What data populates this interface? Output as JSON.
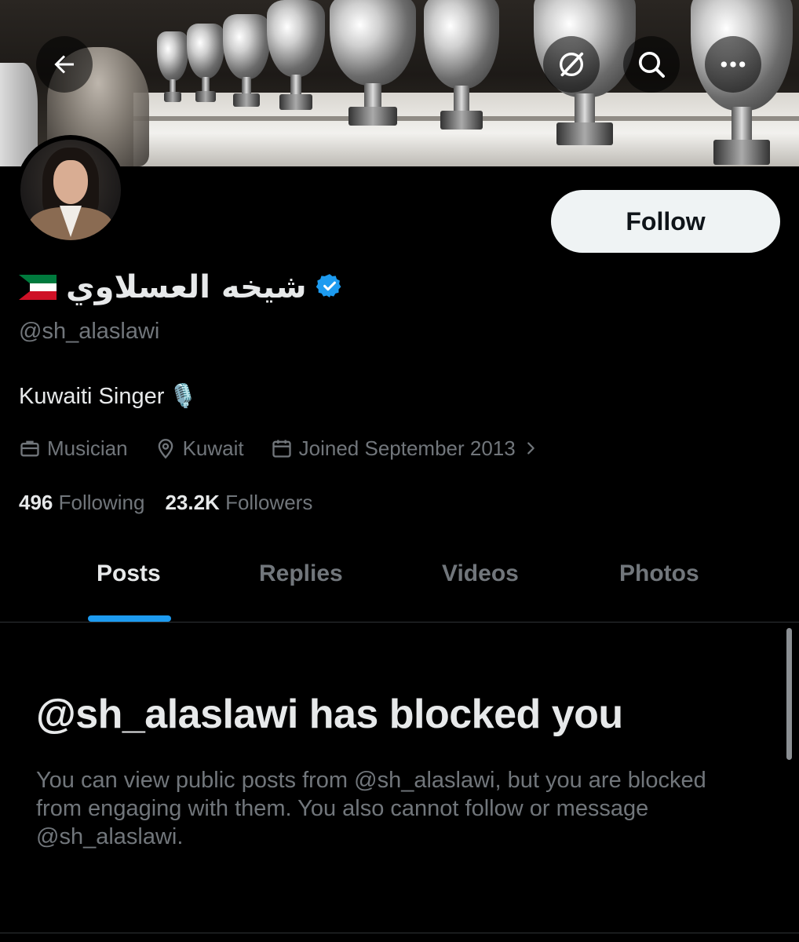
{
  "header": {
    "back_icon": "arrow-left-icon",
    "grok_icon": "grok-slash-circle-icon",
    "search_icon": "search-icon",
    "more_icon": "more-horizontal-icon"
  },
  "profile": {
    "display_name": "شيخه العسلاوي",
    "flag_icon": "kuwait-flag-icon",
    "verified_icon": "verified-badge-icon",
    "verified_color": "#1d9bf0",
    "handle": "@sh_alaslawi",
    "bio": "Kuwaiti Singer",
    "bio_emoji": "🎙️",
    "category": "Musician",
    "location": "Kuwait",
    "joined": "Joined September 2013",
    "following_count": "496",
    "following_label": "Following",
    "followers_count": "23.2K",
    "followers_label": "Followers",
    "follow_button": "Follow"
  },
  "tabs": [
    {
      "label": "Posts",
      "active": true
    },
    {
      "label": "Replies",
      "active": false
    },
    {
      "label": "Videos",
      "active": false
    },
    {
      "label": "Photos",
      "active": false
    }
  ],
  "blocked": {
    "title": "@sh_alaslawi has blocked you",
    "description": "You can view public posts from @sh_alaslawi, but you are blocked from engaging with them. You also cannot follow or message @sh_alaslawi."
  },
  "colors": {
    "background": "#000000",
    "text_primary": "#e7e9ea",
    "text_secondary": "#71767b",
    "accent": "#1d9bf0",
    "follow_bg": "#eff3f4"
  }
}
